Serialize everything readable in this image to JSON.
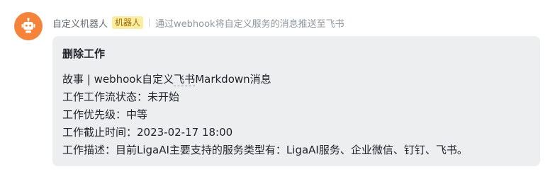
{
  "message": {
    "sender_name": "自定义机器人",
    "sender_badge": "机器人",
    "sender_description": "通过webhook将自定义服务的消息推送至飞书",
    "avatar_icon": "robot-icon",
    "avatar_color": "#f5843a"
  },
  "card": {
    "title": "删除工作",
    "line1_prefix": "故事 | webhook自定义",
    "line1_link": "飞书",
    "line1_suffix": "Markdown消息",
    "status_line": "工作工作流状态：未开始",
    "priority_line": "工作优先级：中等",
    "deadline_line": "工作截止时间：2023-02-17 18:00",
    "description_line": "工作描述：目前LigaAI主要支持的服务类型有：LigaAI服务、企业微信、钉钉、飞书。"
  }
}
